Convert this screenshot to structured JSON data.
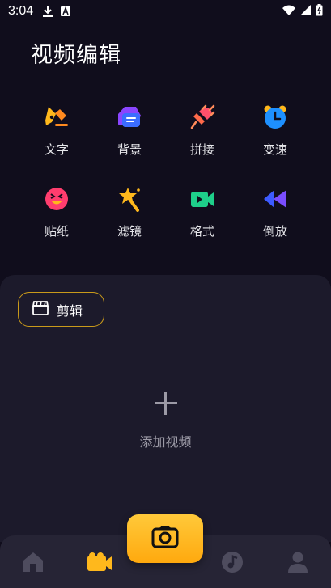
{
  "status": {
    "time": "3:04",
    "icons": [
      "download-icon",
      "a-badge-icon",
      "wifi-icon",
      "signal-icon",
      "battery-icon"
    ]
  },
  "page_title": "视频编辑",
  "tools": [
    {
      "label": "文字",
      "icon": "pen-nib-icon"
    },
    {
      "label": "背景",
      "icon": "background-icon"
    },
    {
      "label": "拼接",
      "icon": "plug-icon"
    },
    {
      "label": "变速",
      "icon": "alarm-clock-icon"
    },
    {
      "label": "贴纸",
      "icon": "smiley-sticker-icon"
    },
    {
      "label": "滤镜",
      "icon": "magic-wand-star-icon"
    },
    {
      "label": "格式",
      "icon": "video-camera-icon"
    },
    {
      "label": "倒放",
      "icon": "rewind-icon"
    }
  ],
  "clip_chip": {
    "label": "剪辑",
    "icon": "clapperboard-icon"
  },
  "add_video": {
    "label": "添加视频"
  },
  "tabbar": {
    "tabs": [
      "home-icon",
      "video-icon",
      "camera-icon",
      "music-icon",
      "profile-icon"
    ],
    "active": "video-icon"
  },
  "colors": {
    "background": "#100d1c",
    "panel": "#1c1a2b",
    "tabbar": "#262435",
    "accent_yellow": "#ffb81c",
    "chip_border": "#c99a1a"
  }
}
